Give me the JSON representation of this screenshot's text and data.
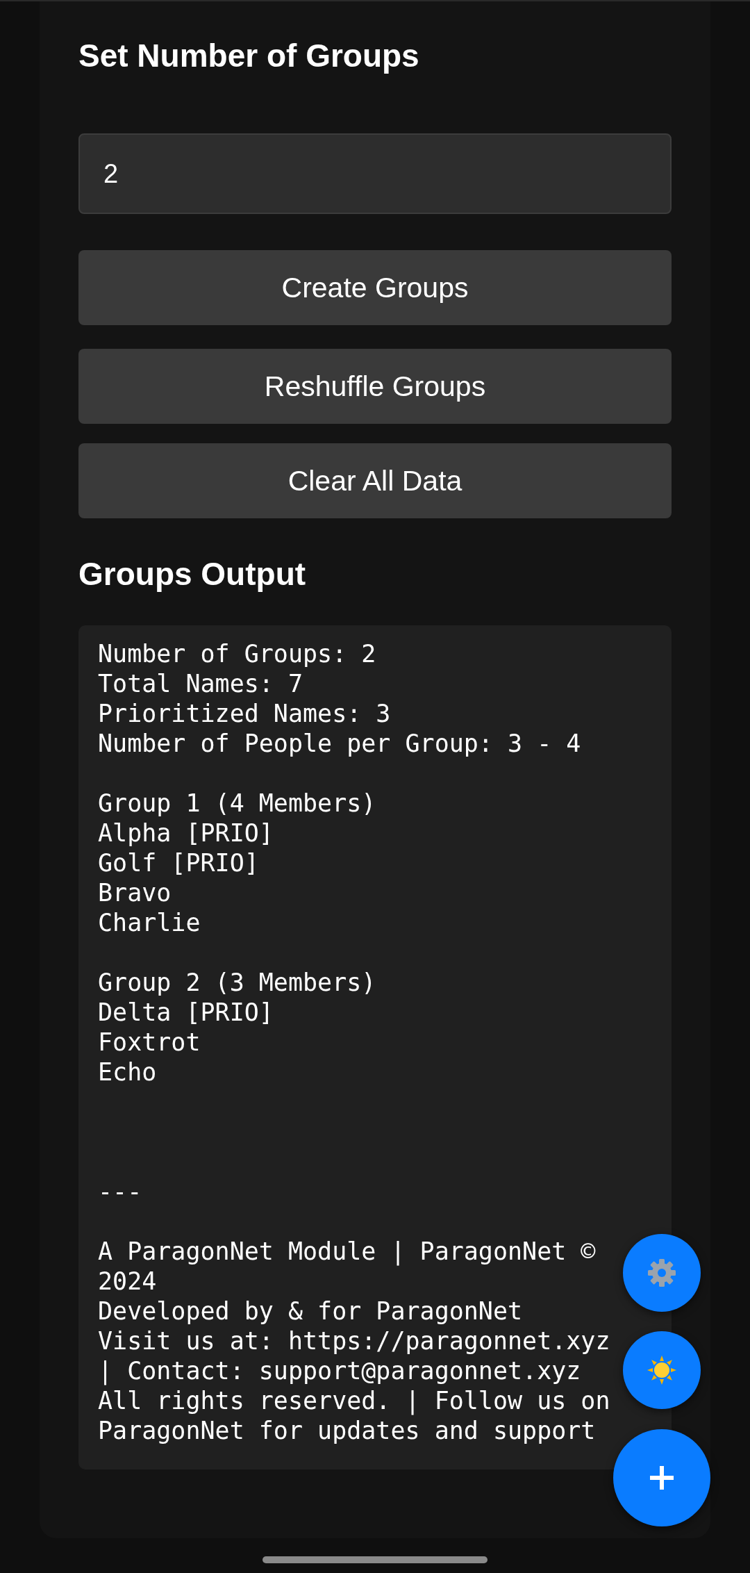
{
  "sections": [
    {
      "title": "Set Number of Groups"
    },
    {
      "title": "Groups Output"
    }
  ],
  "group_count_field": {
    "value": "2"
  },
  "buttons": [
    "Create Groups",
    "Reshuffle Groups",
    "Clear All Data"
  ],
  "output": {
    "blocks": [
      {
        "kind": "text",
        "lines": [
          "Number of Groups: 2",
          "Total Names: 7",
          "Prioritized Names: 3",
          "Number of People per Group: 3 - 4"
        ]
      },
      {
        "kind": "text",
        "lines": [
          "Group 1 (4 Members)",
          "Alpha [PRIO]",
          "Golf [PRIO]",
          "Bravo",
          "Charlie"
        ]
      },
      {
        "kind": "text",
        "lines": [
          "Group 2 (3 Members)",
          "Delta [PRIO]",
          "Foxtrot",
          "Echo"
        ]
      },
      {
        "kind": "rule",
        "lines": [
          "---"
        ]
      },
      {
        "kind": "text",
        "lines": [
          "A ParagonNet Module | ParagonNet ©",
          "2024",
          "Developed by & for ParagonNet",
          "Visit us at: https://paragonnet.xyz",
          "| Contact: support@paragonnet.xyz",
          "All rights reserved. | Follow us on",
          "ParagonNet for updates and support"
        ]
      }
    ]
  },
  "fabs": [
    {
      "kind": "settings"
    },
    {
      "kind": "theme"
    },
    {
      "kind": "add"
    }
  ]
}
